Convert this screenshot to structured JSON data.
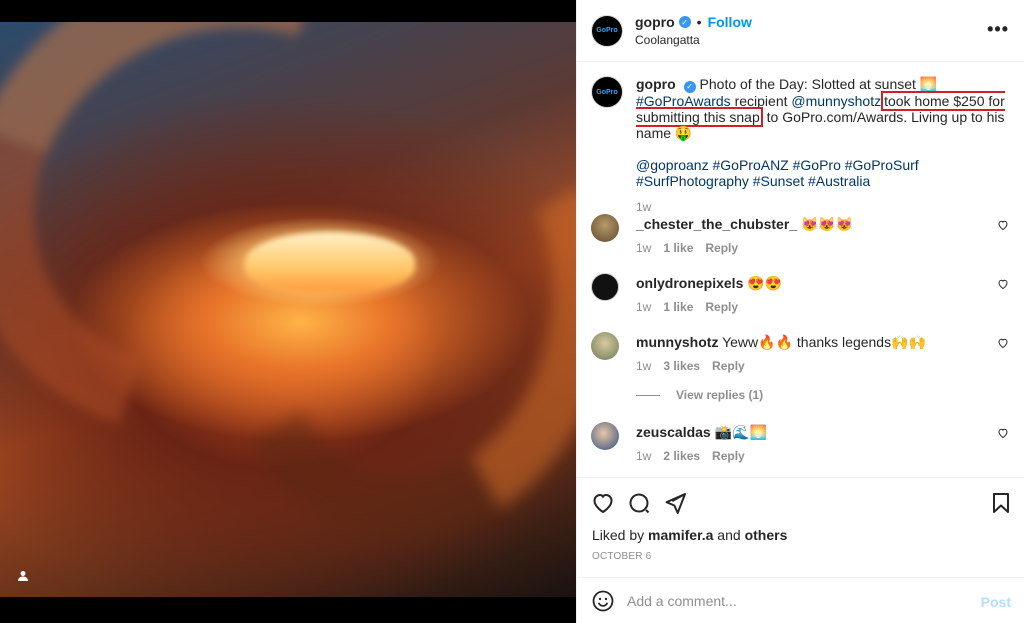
{
  "post": {
    "username": "gopro",
    "follow_label": "Follow",
    "separator": "•",
    "location": "Coolangatta",
    "more_label": "•••",
    "avatar_text": "GoPro"
  },
  "caption": {
    "username": "gopro",
    "text_part1": "Photo of the Day: Slotted at sunset 🌅 ",
    "hashtag_awards": "#GoProAwards",
    "text_part2": " recipient ",
    "mention": "@munnyshotz",
    "highlighted": "took home $250 for submitting this snap",
    "text_part3": " to GoPro.com/Awards. Living up to his name 🤑",
    "tags": "@goproanz #GoProANZ #GoPro #GoProSurf #SurfPhotography #Sunset #Australia",
    "time": "1w"
  },
  "comments": [
    {
      "username": "_chester_the_chubster_",
      "text": "😻😻😻",
      "time": "1w",
      "likes": "1 like",
      "reply": "Reply"
    },
    {
      "username": "onlydronepixels",
      "text": "😍😍",
      "time": "1w",
      "likes": "1 like",
      "reply": "Reply"
    },
    {
      "username": "munnyshotz",
      "text": "Yeww🔥🔥 thanks legends🙌🙌",
      "time": "1w",
      "likes": "3 likes",
      "reply": "Reply"
    },
    {
      "username": "zeuscaldas",
      "text": "📸🌊🌅",
      "time": "1w",
      "likes": "2 likes",
      "reply": "Reply"
    }
  ],
  "view_replies": "View replies (1)",
  "likes": {
    "prefix": "Liked by ",
    "user": "mamifer.a",
    "and": " and ",
    "others": "others"
  },
  "date": "OCTOBER 6",
  "add_comment": {
    "placeholder": "Add a comment...",
    "post_label": "Post"
  },
  "icons": [
    "user-tag-icon",
    "verified-badge-icon",
    "more-options-icon",
    "heart-icon",
    "comment-icon",
    "share-icon",
    "bookmark-icon",
    "emoji-icon"
  ]
}
